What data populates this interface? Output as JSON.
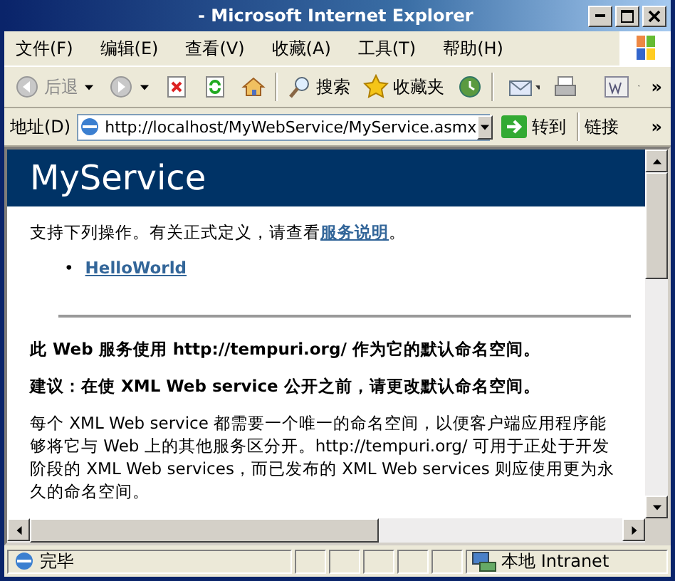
{
  "window": {
    "title": "- Microsoft Internet Explorer"
  },
  "menu": [
    "文件(F)",
    "编辑(E)",
    "查看(V)",
    "收藏(A)",
    "工具(T)",
    "帮助(H)"
  ],
  "toolbar": [
    {
      "kind": "back",
      "label": "后退"
    },
    {
      "kind": "forward"
    },
    {
      "kind": "stop"
    },
    {
      "kind": "refresh"
    },
    {
      "kind": "home"
    },
    {
      "kind": "search",
      "label": "搜索"
    },
    {
      "kind": "favorites",
      "label": "收藏夹"
    },
    {
      "kind": "history"
    },
    {
      "kind": "mail"
    },
    {
      "kind": "print"
    },
    {
      "kind": "edit"
    }
  ],
  "toolbar_more": "»",
  "address_bar": {
    "label": "地址(D)",
    "url": "http://localhost/MyWebService/MyService.asmx",
    "go": "转到",
    "links": "链接",
    "more": "»"
  },
  "page": {
    "heading": "MyService",
    "intro": {
      "text": "支持下列操作。有关正式定义，请查看",
      "link": "服务说明",
      "end": "。"
    },
    "operations": [
      {
        "marker": "•",
        "name": "HelloWorld"
      }
    ],
    "notes": [
      {
        "kind": "bold",
        "text": "此 Web 服务使用 http://tempuri.org/ 作为它的默认命名空间。"
      },
      {
        "kind": "bold",
        "text": "建议：在使 XML Web service 公开之前，请更改默认命名空间。"
      },
      {
        "kind": "plain",
        "text": "每个 XML Web service 都需要一个唯一的命名空间，以便客户端应用程序能够将它与 Web 上的其他服务区分开。http://tempuri.org/ 可用于正处于开发阶段的 XML Web services，而已发布的 XML Web services 则应使用更为永久的命名空间。"
      }
    ]
  },
  "status_bar": {
    "text": "完毕",
    "zone": "本地 Intranet"
  }
}
